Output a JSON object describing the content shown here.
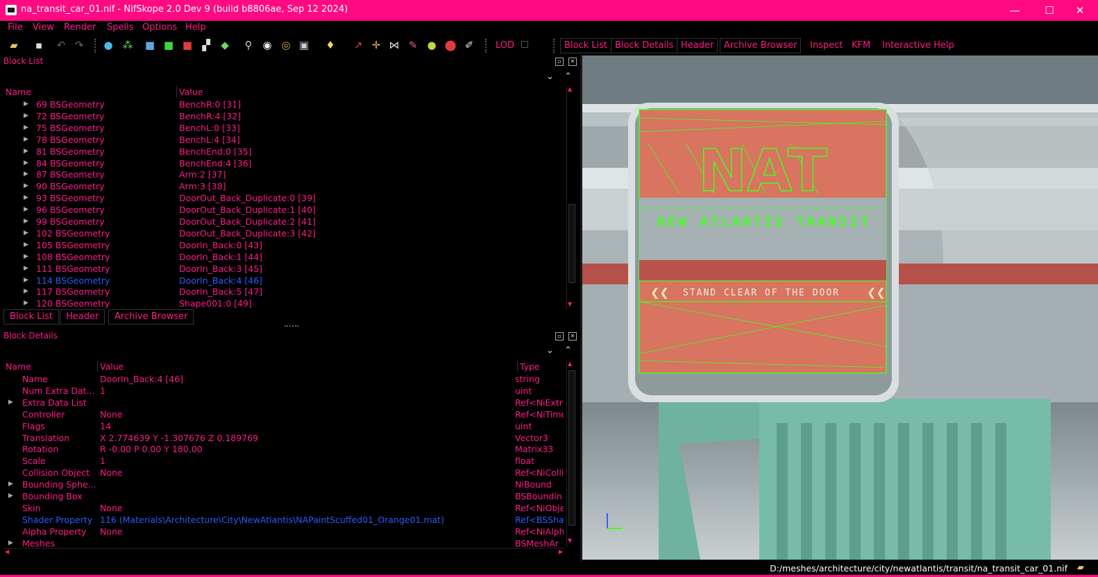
{
  "window": {
    "title": "na_transit_car_01.nif - NifSkope 2.0 Dev 9 (build b8806ae, Sep 12 2024)",
    "minimize": "—",
    "maximize": "☐",
    "close": "✕"
  },
  "menu": [
    "File",
    "View",
    "Render",
    "Spells",
    "Options",
    "Help"
  ],
  "toolbar": {
    "lod_label": "LOD",
    "tabs": [
      "Block List",
      "Block Details",
      "Header",
      "Archive Browser"
    ],
    "links": [
      "Inspect",
      "KFM",
      "Interactive Help"
    ]
  },
  "block_list": {
    "title": "Block List",
    "col_name": "Name",
    "col_value": "Value",
    "rows": [
      {
        "name": "69 BSGeometry",
        "value": "BenchR:0 [31]"
      },
      {
        "name": "72 BSGeometry",
        "value": "BenchR:4 [32]"
      },
      {
        "name": "75 BSGeometry",
        "value": "BenchL:0 [33]"
      },
      {
        "name": "78 BSGeometry",
        "value": "BenchL:4 [34]"
      },
      {
        "name": "81 BSGeometry",
        "value": "BenchEnd:0 [35]"
      },
      {
        "name": "84 BSGeometry",
        "value": "BenchEnd:4 [36]"
      },
      {
        "name": "87 BSGeometry",
        "value": "Arm:2 [37]"
      },
      {
        "name": "90 BSGeometry",
        "value": "Arm:3 [38]"
      },
      {
        "name": "93 BSGeometry",
        "value": "DoorOut_Back_Duplicate:0 [39]"
      },
      {
        "name": "96 BSGeometry",
        "value": "DoorOut_Back_Duplicate:1 [40]"
      },
      {
        "name": "99 BSGeometry",
        "value": "DoorOut_Back_Duplicate:2 [41]"
      },
      {
        "name": "102 BSGeometry",
        "value": "DoorOut_Back_Duplicate:3 [42]"
      },
      {
        "name": "105 BSGeometry",
        "value": "DoorIn_Back:0 [43]"
      },
      {
        "name": "108 BSGeometry",
        "value": "DoorIn_Back:1 [44]"
      },
      {
        "name": "111 BSGeometry",
        "value": "DoorIn_Back:3 [45]"
      },
      {
        "name": "114 BSGeometry",
        "value": "DoorIn_Back:4 [46]",
        "selected": true
      },
      {
        "name": "117 BSGeometry",
        "value": "DoorIn_Back:5 [47]"
      },
      {
        "name": "120 BSGeometry",
        "value": "Shape001:0 [49]"
      }
    ],
    "bottom_tabs": [
      "Block List",
      "Header",
      "Archive Browser"
    ]
  },
  "block_details": {
    "title": "Block Details",
    "col_name": "Name",
    "col_value": "Value",
    "col_type": "Type",
    "rows": [
      {
        "name": "Name",
        "value": "DoorIn_Back:4 [46]",
        "type": "string"
      },
      {
        "name": "Num Extra Dat...",
        "value": "1",
        "type": "uint"
      },
      {
        "name": "Extra Data List",
        "value": "",
        "type": "Ref<NiExtr",
        "expand": true
      },
      {
        "name": "Controller",
        "value": "None",
        "type": "Ref<NiTime"
      },
      {
        "name": "Flags",
        "value": "14",
        "type": "uint"
      },
      {
        "name": "Translation",
        "value": "X 2.774639 Y -1.307676 Z 0.189769",
        "type": "Vector3"
      },
      {
        "name": "Rotation",
        "value": "R -0.00 P 0.00 Y 180.00",
        "type": "Matrix33"
      },
      {
        "name": "Scale",
        "value": "1",
        "type": "float"
      },
      {
        "name": "Collision Object",
        "value": "None",
        "type": "Ref<NiColli"
      },
      {
        "name": "Bounding Sphe...",
        "value": "",
        "type": "NiBound",
        "expand": true
      },
      {
        "name": "Bounding Box",
        "value": "",
        "type": "BSBoundin",
        "expand": true
      },
      {
        "name": "Skin",
        "value": "None",
        "type": "Ref<NiObje"
      },
      {
        "name": "Shader Property",
        "value": "116 (Materials\\Architecture\\City\\NewAtlantis\\NAPaintScuffed01_Orange01.mat)",
        "type": "Ref<BSSha",
        "selected": true
      },
      {
        "name": "Alpha Property",
        "value": "None",
        "type": "Ref<NiAlph"
      },
      {
        "name": "Meshes",
        "value": "",
        "type": "BSMeshAr",
        "expand": true
      }
    ]
  },
  "viewport": {
    "sign_top": "NAT",
    "sign_sub": "NEW ATLANTIS TRANSIT",
    "sign_bottom": "STAND CLEAR OF THE DOOR",
    "sign_arrows_left": "❮❮",
    "sign_arrows_right": "❮❮"
  },
  "status": {
    "path": "D:/meshes/architecture/city/newatlantis/transit/na_transit_car_01.nif"
  }
}
